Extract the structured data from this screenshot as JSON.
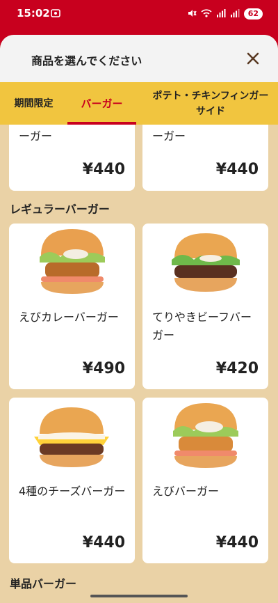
{
  "status_bar": {
    "time": "15:02",
    "battery": "62"
  },
  "sheet": {
    "title": "商品を選んでください",
    "close_label": "×"
  },
  "tabs": [
    {
      "label": "期間限定"
    },
    {
      "label": "バーガー",
      "active": true
    },
    {
      "label_line1": "ポテト・チキンフィンガー",
      "label_line2": "サイド"
    }
  ],
  "top_cards": [
    {
      "name": "ーガー",
      "price": "¥440"
    },
    {
      "name": "ーガー",
      "price": "¥440"
    }
  ],
  "sections": {
    "regular": "レギュラーバーガー",
    "single": "単品バーガー"
  },
  "regular_items": [
    {
      "name": "えびカレーバーガー",
      "price": "¥490",
      "image_icon": "ebi-curry-burger-image"
    },
    {
      "name": "てりやきビーフバーガー",
      "price": "¥420",
      "image_icon": "teriyaki-beef-burger-image"
    },
    {
      "name": "4種のチーズバーガー",
      "price": "¥440",
      "image_icon": "four-cheese-burger-image"
    },
    {
      "name": "えびバーガー",
      "price": "¥440",
      "image_icon": "ebi-burger-image"
    }
  ],
  "colors": {
    "brand_red": "#c8001e",
    "tab_yellow": "#f1c53f",
    "background_beige": "#ead2a6"
  }
}
